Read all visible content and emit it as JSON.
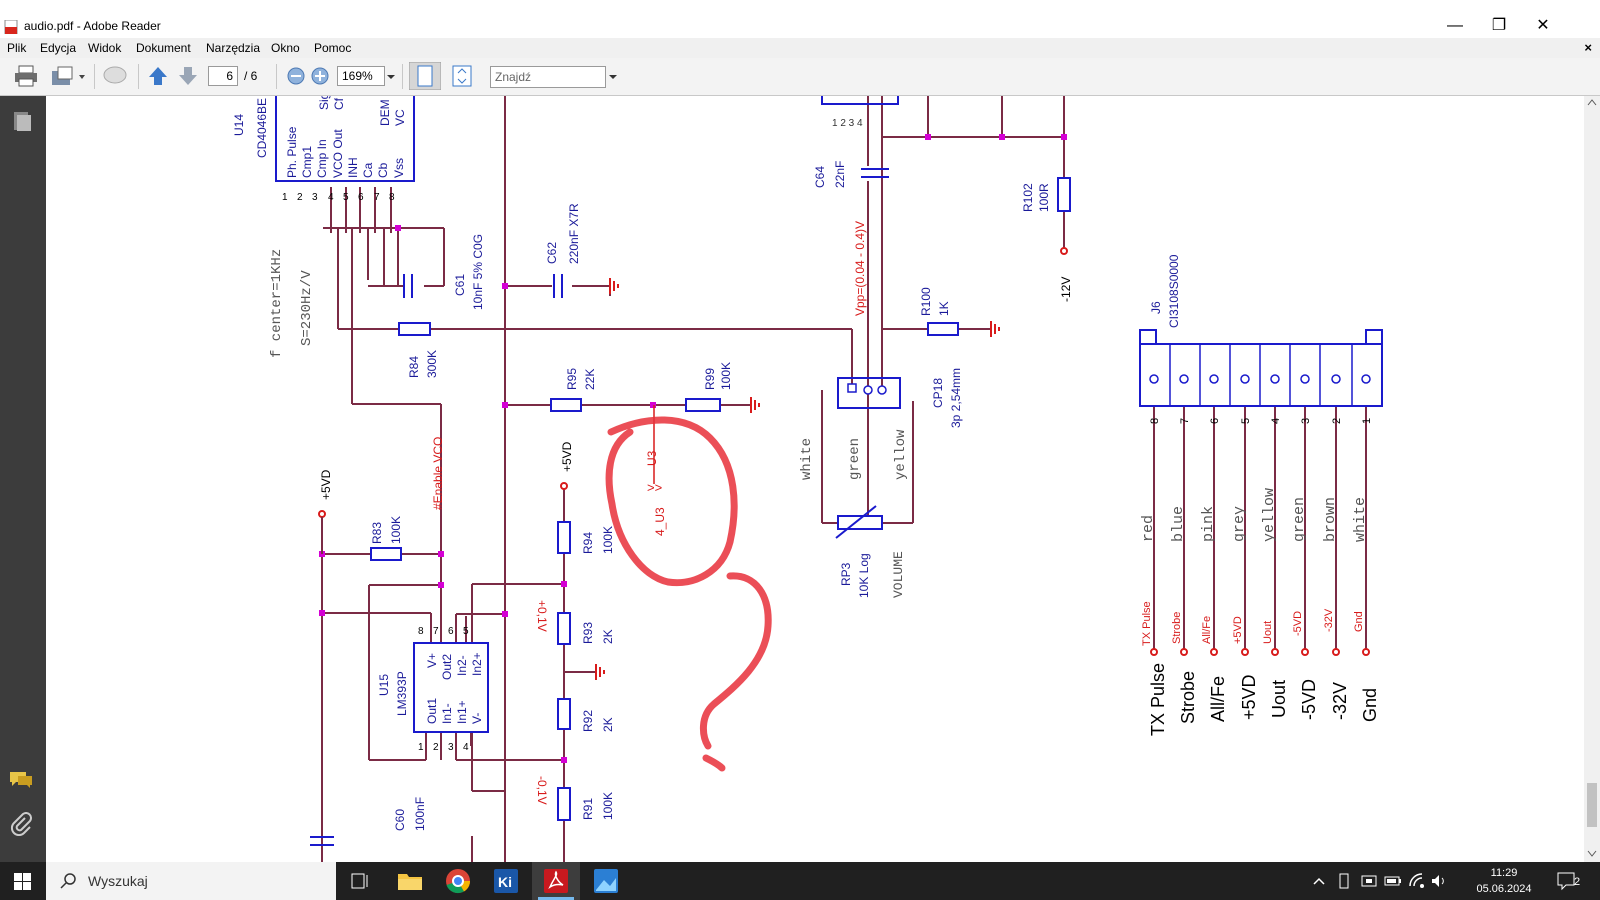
{
  "window": {
    "title": "audio.pdf - Adobe Reader"
  },
  "menu": {
    "items": [
      "Plik",
      "Edycja",
      "Widok",
      "Dokument",
      "Narzędzia",
      "Okno",
      "Pomoc"
    ],
    "close": "×"
  },
  "toolbar": {
    "page_current": "6",
    "page_total": "/ 6",
    "zoom": "169%",
    "find_placeholder": "Znajdź"
  },
  "schematic": {
    "u14": {
      "ref": "U14",
      "part": "CD4046BE",
      "pins_top": [
        "Ph. Pulse",
        "Cmp1",
        "Cmp In",
        "VCO Out",
        "INH",
        "Ca",
        "Cb",
        "Vss"
      ],
      "pins_bottom": [
        "Sig",
        "Cf",
        "DEM",
        "VC"
      ],
      "pin_nums": [
        "1",
        "2",
        "3",
        "4",
        "5",
        "6",
        "7",
        "8"
      ]
    },
    "notes": {
      "f_center": "f center=1KHz",
      "s": "S=230Hz/V"
    },
    "c61": {
      "ref": "C61",
      "val": "10nF 5% C0G"
    },
    "c62": {
      "ref": "C62",
      "val": "220nF X7R"
    },
    "c64": {
      "ref": "C64",
      "val": "22nF"
    },
    "c60": {
      "ref": "C60",
      "val": "100nF"
    },
    "r84": {
      "ref": "R84",
      "val": "300K"
    },
    "r95": {
      "ref": "R95",
      "val": "22K"
    },
    "r99": {
      "ref": "R99",
      "val": "100K"
    },
    "r83": {
      "ref": "R83",
      "val": "100K"
    },
    "r94": {
      "ref": "R94",
      "val": "100K"
    },
    "r93": {
      "ref": "R93",
      "val": "2K"
    },
    "r92": {
      "ref": "R92",
      "val": "2K"
    },
    "r91": {
      "ref": "R91",
      "val": "100K"
    },
    "r100": {
      "ref": "R100",
      "val": "1K"
    },
    "r102": {
      "ref": "R102",
      "val": "100R"
    },
    "rp3": {
      "ref": "RP3",
      "val": "10K Log",
      "name": "VOLUME"
    },
    "cp18": {
      "ref": "CP18",
      "val": "3p 2,54mm"
    },
    "u15": {
      "ref": "U15",
      "part": "LM393P",
      "pins_left": [
        "Out1",
        "In1-",
        "In1+",
        "V-"
      ],
      "pins_right": [
        "V+",
        "Out2",
        "In2-",
        "In2+"
      ],
      "nums_bottom": [
        "1",
        "2",
        "3",
        "4"
      ],
      "nums_top": [
        "8",
        "7",
        "6",
        "5"
      ]
    },
    "j6": {
      "ref": "J6",
      "part": "CI3108S0000",
      "pin_nums": [
        "8",
        "7",
        "6",
        "5",
        "4",
        "3",
        "2",
        "1"
      ],
      "wire_colors": [
        "red",
        "blue",
        "pink",
        "grey",
        "yellow",
        "green",
        "brown",
        "white"
      ],
      "net_labels": [
        "TX Pulse",
        "Strobe",
        "All/Fe",
        "+5VD",
        "Uout",
        "-5VD",
        "-32V",
        "Gnd"
      ],
      "big_labels": [
        "TX Pulse",
        "Strobe",
        "All/Fe",
        "+5VD",
        "Uout",
        "-5VD",
        "-32V",
        "Gnd"
      ]
    },
    "pot_wires": [
      "white",
      "green",
      "yellow"
    ],
    "labels": {
      "vpp": "Vpp=(0.04 - 0.4)V",
      "enable_vco": "#Enable VCO",
      "u3": "U3",
      "u3_pin": "4_U3",
      "plus5vd": "+5VD",
      "minus12v": "-12V",
      "plus01v": "+0,1V",
      "minus01v": "-0,1V"
    }
  },
  "taskbar": {
    "search_placeholder": "Wyszukaj",
    "time": "11:29",
    "date": "05.06.2024",
    "notif_count": "2"
  }
}
